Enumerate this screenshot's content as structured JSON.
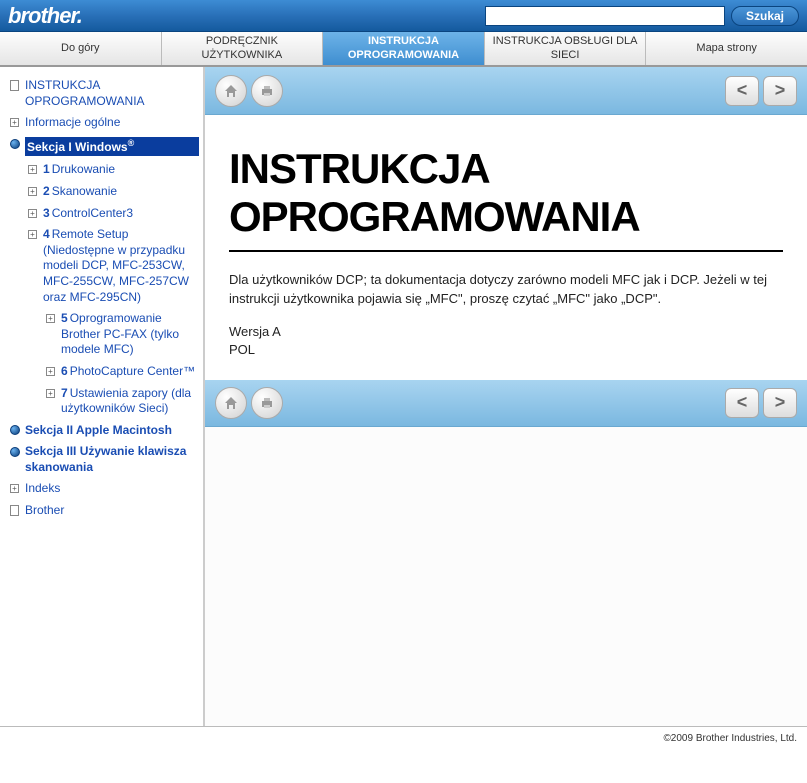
{
  "header": {
    "brand": "brother.",
    "search_placeholder": "",
    "search_button": "Szukaj"
  },
  "nav": {
    "tabs": [
      {
        "label": "Do góry",
        "active": false
      },
      {
        "label": "PODRĘCZNIK UŻYTKOWNIKA",
        "active": false
      },
      {
        "label": "INSTRUKCJA OPROGRAMOWANIA",
        "active": true
      },
      {
        "label": "INSTRUKCJA OBSŁUGI DLA SIECI",
        "active": false
      },
      {
        "label": "Mapa strony",
        "active": false
      }
    ]
  },
  "sidebar": {
    "items": [
      {
        "icon": "doc",
        "label": "INSTRUKCJA OPROGRAMOWANIA"
      },
      {
        "icon": "plus",
        "label": "Informacje ogólne"
      },
      {
        "icon": "bullet",
        "label": "Sekcja I Windows",
        "sup": "®",
        "selected": true,
        "children": [
          {
            "icon": "plus",
            "num": "1",
            "label": "Drukowanie"
          },
          {
            "icon": "plus",
            "num": "2",
            "label": "Skanowanie"
          },
          {
            "icon": "plus",
            "num": "3",
            "label": "ControlCenter3"
          },
          {
            "icon": "plus",
            "num": "4",
            "label": "Remote Setup (Niedostępne w przypadku modeli DCP, MFC-253CW, MFC-255CW, MFC-257CW oraz MFC-295CN)"
          },
          {
            "icon": "plus",
            "num": "5",
            "label": "Oprogramowanie Brother PC-FAX (tylko modele MFC)"
          },
          {
            "icon": "plus",
            "num": "6",
            "label": "PhotoCapture Center™"
          },
          {
            "icon": "plus",
            "num": "7",
            "label": "Ustawienia zapory (dla użytkowników Sieci)"
          }
        ]
      },
      {
        "icon": "bullet",
        "label": "Sekcja II Apple Macintosh",
        "bold": true
      },
      {
        "icon": "bullet",
        "label": "Sekcja III Używanie klawisza skanowania",
        "bold": true
      },
      {
        "icon": "plus",
        "label": "Indeks"
      },
      {
        "icon": "doc",
        "label": "Brother"
      }
    ]
  },
  "content": {
    "title": "INSTRUKCJA OPROGRAMOWANIA",
    "paragraph": "Dla użytkowników DCP; ta dokumentacja dotyczy zarówno modeli MFC jak i DCP. Jeżeli w tej instrukcji użytkownika pojawia się „MFC\", proszę czytać „MFC\" jako „DCP\".",
    "version": "Wersja A",
    "lang": "POL"
  },
  "footer": {
    "copyright": "©2009 Brother Industries, Ltd."
  },
  "icons": {
    "home": "⌂",
    "print": "⎙",
    "prev": "<",
    "next": ">"
  }
}
